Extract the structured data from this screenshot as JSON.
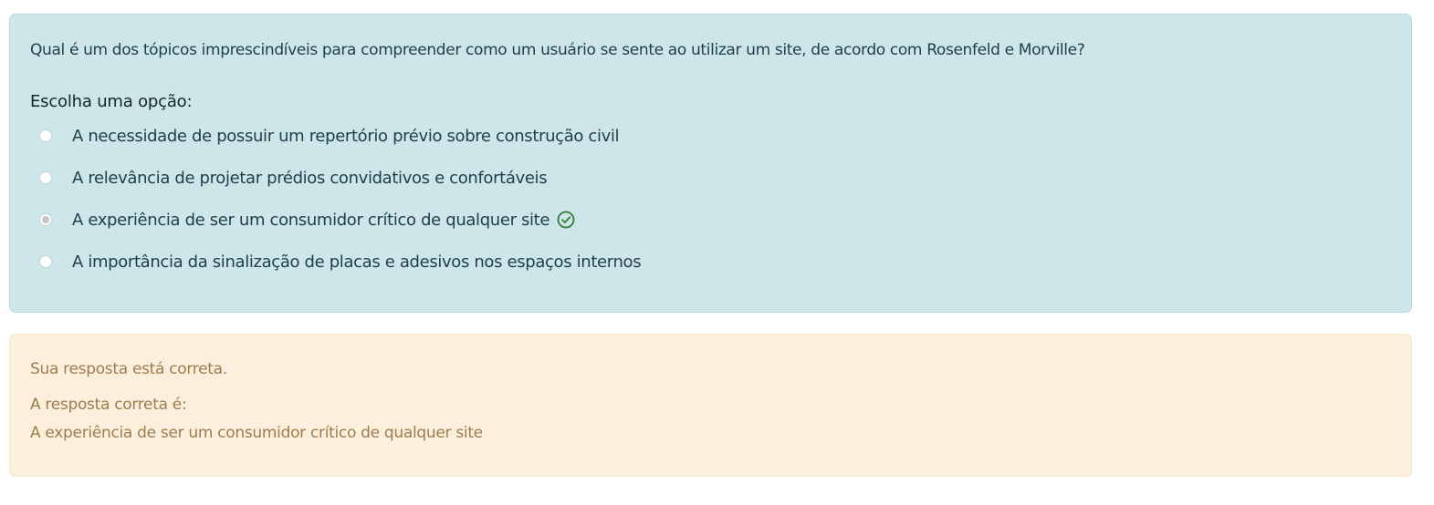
{
  "question": {
    "text": "Qual é um dos tópicos imprescindíveis para compreender como um usuário se sente ao utilizar um site, de acordo com Rosenfeld e Morville?",
    "prompt": "Escolha uma opção:",
    "options": [
      {
        "label": "A necessidade de possuir um repertório prévio sobre construção civil",
        "selected": false
      },
      {
        "label": "A relevância de projetar prédios convidativos e confortáveis",
        "selected": false
      },
      {
        "label": "A experiência de ser um consumidor crítico de qualquer site",
        "selected": true,
        "icon": "check-circle-icon"
      },
      {
        "label": "A importância da sinalização de placas e adesivos nos espaços internos",
        "selected": false
      }
    ]
  },
  "feedback": {
    "status": "Sua resposta está correta.",
    "correct_label": "A resposta correta é:",
    "correct_answer": "A experiência de ser um consumidor crítico de qualquer site"
  },
  "colors": {
    "question_bg": "#cce6ea",
    "feedback_bg": "#fcefdc",
    "feedback_text": "#9c7d4f",
    "correct_icon": "#2e7d32"
  }
}
